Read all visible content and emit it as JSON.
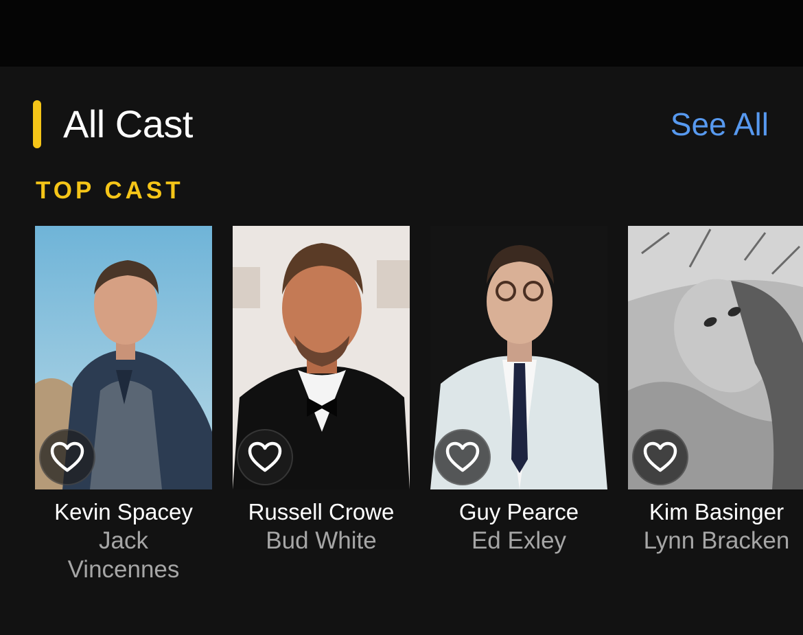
{
  "section": {
    "title": "All Cast",
    "see_all_label": "See All",
    "subheading": "TOP CAST"
  },
  "colors": {
    "accent": "#f5c518",
    "link": "#5799ef",
    "background": "#121212"
  },
  "cast": [
    {
      "actor": "Kevin Spacey",
      "role": "Jack Vincennes",
      "photo_icon": "actor-photo",
      "favorite_icon": "heart-icon"
    },
    {
      "actor": "Russell Crowe",
      "role": "Bud White",
      "photo_icon": "actor-photo",
      "favorite_icon": "heart-icon"
    },
    {
      "actor": "Guy Pearce",
      "role": "Ed Exley",
      "photo_icon": "actor-photo",
      "favorite_icon": "heart-icon"
    },
    {
      "actor": "Kim Basinger",
      "role": "Lynn Bracken",
      "photo_icon": "actor-photo",
      "favorite_icon": "heart-icon"
    }
  ]
}
